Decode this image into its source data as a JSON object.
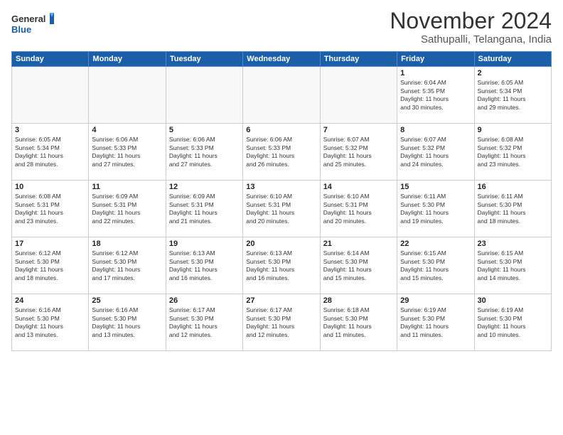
{
  "logo": {
    "line1": "General",
    "line2": "Blue"
  },
  "title": "November 2024",
  "subtitle": "Sathupalli, Telangana, India",
  "weekdays": [
    "Sunday",
    "Monday",
    "Tuesday",
    "Wednesday",
    "Thursday",
    "Friday",
    "Saturday"
  ],
  "weeks": [
    [
      {
        "day": "",
        "info": ""
      },
      {
        "day": "",
        "info": ""
      },
      {
        "day": "",
        "info": ""
      },
      {
        "day": "",
        "info": ""
      },
      {
        "day": "",
        "info": ""
      },
      {
        "day": "1",
        "info": "Sunrise: 6:04 AM\nSunset: 5:35 PM\nDaylight: 11 hours\nand 30 minutes."
      },
      {
        "day": "2",
        "info": "Sunrise: 6:05 AM\nSunset: 5:34 PM\nDaylight: 11 hours\nand 29 minutes."
      }
    ],
    [
      {
        "day": "3",
        "info": "Sunrise: 6:05 AM\nSunset: 5:34 PM\nDaylight: 11 hours\nand 28 minutes."
      },
      {
        "day": "4",
        "info": "Sunrise: 6:06 AM\nSunset: 5:33 PM\nDaylight: 11 hours\nand 27 minutes."
      },
      {
        "day": "5",
        "info": "Sunrise: 6:06 AM\nSunset: 5:33 PM\nDaylight: 11 hours\nand 27 minutes."
      },
      {
        "day": "6",
        "info": "Sunrise: 6:06 AM\nSunset: 5:33 PM\nDaylight: 11 hours\nand 26 minutes."
      },
      {
        "day": "7",
        "info": "Sunrise: 6:07 AM\nSunset: 5:32 PM\nDaylight: 11 hours\nand 25 minutes."
      },
      {
        "day": "8",
        "info": "Sunrise: 6:07 AM\nSunset: 5:32 PM\nDaylight: 11 hours\nand 24 minutes."
      },
      {
        "day": "9",
        "info": "Sunrise: 6:08 AM\nSunset: 5:32 PM\nDaylight: 11 hours\nand 23 minutes."
      }
    ],
    [
      {
        "day": "10",
        "info": "Sunrise: 6:08 AM\nSunset: 5:31 PM\nDaylight: 11 hours\nand 23 minutes."
      },
      {
        "day": "11",
        "info": "Sunrise: 6:09 AM\nSunset: 5:31 PM\nDaylight: 11 hours\nand 22 minutes."
      },
      {
        "day": "12",
        "info": "Sunrise: 6:09 AM\nSunset: 5:31 PM\nDaylight: 11 hours\nand 21 minutes."
      },
      {
        "day": "13",
        "info": "Sunrise: 6:10 AM\nSunset: 5:31 PM\nDaylight: 11 hours\nand 20 minutes."
      },
      {
        "day": "14",
        "info": "Sunrise: 6:10 AM\nSunset: 5:31 PM\nDaylight: 11 hours\nand 20 minutes."
      },
      {
        "day": "15",
        "info": "Sunrise: 6:11 AM\nSunset: 5:30 PM\nDaylight: 11 hours\nand 19 minutes."
      },
      {
        "day": "16",
        "info": "Sunrise: 6:11 AM\nSunset: 5:30 PM\nDaylight: 11 hours\nand 18 minutes."
      }
    ],
    [
      {
        "day": "17",
        "info": "Sunrise: 6:12 AM\nSunset: 5:30 PM\nDaylight: 11 hours\nand 18 minutes."
      },
      {
        "day": "18",
        "info": "Sunrise: 6:12 AM\nSunset: 5:30 PM\nDaylight: 11 hours\nand 17 minutes."
      },
      {
        "day": "19",
        "info": "Sunrise: 6:13 AM\nSunset: 5:30 PM\nDaylight: 11 hours\nand 16 minutes."
      },
      {
        "day": "20",
        "info": "Sunrise: 6:13 AM\nSunset: 5:30 PM\nDaylight: 11 hours\nand 16 minutes."
      },
      {
        "day": "21",
        "info": "Sunrise: 6:14 AM\nSunset: 5:30 PM\nDaylight: 11 hours\nand 15 minutes."
      },
      {
        "day": "22",
        "info": "Sunrise: 6:15 AM\nSunset: 5:30 PM\nDaylight: 11 hours\nand 15 minutes."
      },
      {
        "day": "23",
        "info": "Sunrise: 6:15 AM\nSunset: 5:30 PM\nDaylight: 11 hours\nand 14 minutes."
      }
    ],
    [
      {
        "day": "24",
        "info": "Sunrise: 6:16 AM\nSunset: 5:30 PM\nDaylight: 11 hours\nand 13 minutes."
      },
      {
        "day": "25",
        "info": "Sunrise: 6:16 AM\nSunset: 5:30 PM\nDaylight: 11 hours\nand 13 minutes."
      },
      {
        "day": "26",
        "info": "Sunrise: 6:17 AM\nSunset: 5:30 PM\nDaylight: 11 hours\nand 12 minutes."
      },
      {
        "day": "27",
        "info": "Sunrise: 6:17 AM\nSunset: 5:30 PM\nDaylight: 11 hours\nand 12 minutes."
      },
      {
        "day": "28",
        "info": "Sunrise: 6:18 AM\nSunset: 5:30 PM\nDaylight: 11 hours\nand 11 minutes."
      },
      {
        "day": "29",
        "info": "Sunrise: 6:19 AM\nSunset: 5:30 PM\nDaylight: 11 hours\nand 11 minutes."
      },
      {
        "day": "30",
        "info": "Sunrise: 6:19 AM\nSunset: 5:30 PM\nDaylight: 11 hours\nand 10 minutes."
      }
    ]
  ]
}
